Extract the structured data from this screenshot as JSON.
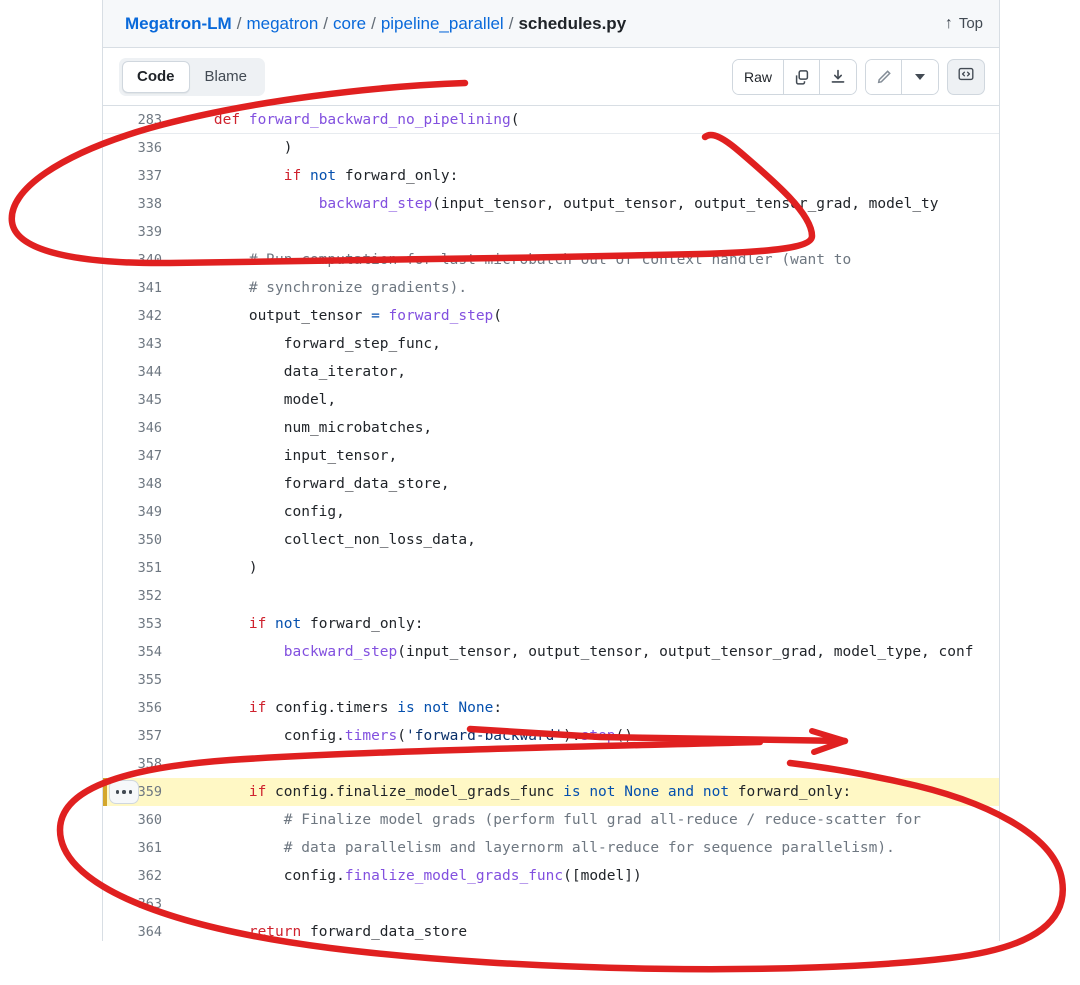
{
  "header": {
    "breadcrumb": {
      "repo": "Megatron-LM",
      "parts": [
        "megatron",
        "core",
        "pipeline_parallel"
      ],
      "current": "schedules.py",
      "separator": "/"
    },
    "top_link": {
      "label": "Top",
      "icon": "arrow-up-icon",
      "glyph": "↑"
    }
  },
  "toolbar": {
    "tabs": [
      {
        "label": "Code",
        "active": true
      },
      {
        "label": "Blame",
        "active": false
      }
    ],
    "raw_label": "Raw",
    "copy_icon": "copy-icon",
    "download_icon": "download-icon",
    "edit_icon": "pencil-icon",
    "dropdown_icon": "chevron-down-icon",
    "symbols_icon": "code-brackets-icon"
  },
  "sticky": {
    "number": "283",
    "tokens": [
      {
        "t": "    ",
        "c": "plain"
      },
      {
        "t": "def",
        "c": "kw"
      },
      {
        "t": " ",
        "c": "plain"
      },
      {
        "t": "forward_backward_no_pipelining",
        "c": "fn"
      },
      {
        "t": "(",
        "c": "plain"
      }
    ]
  },
  "colors": {
    "accent_link": "#0969da",
    "keyword": "#cf222e",
    "function": "#8250df",
    "operator": "#0550ae",
    "comment": "#6e7781",
    "highlight_bg": "#fff8c5",
    "highlight_border": "#d4a72c",
    "annotation": "#e02020",
    "panel_border": "#d8dee4",
    "header_bg": "#f6f8fa"
  },
  "code_lines": [
    {
      "number": "336",
      "highlight": false,
      "tokens": [
        {
          "t": "            )",
          "c": "plain"
        }
      ]
    },
    {
      "number": "337",
      "highlight": false,
      "tokens": [
        {
          "t": "            ",
          "c": "plain"
        },
        {
          "t": "if",
          "c": "kw"
        },
        {
          "t": " ",
          "c": "plain"
        },
        {
          "t": "not",
          "c": "op"
        },
        {
          "t": " forward_only:",
          "c": "plain"
        }
      ]
    },
    {
      "number": "338",
      "highlight": false,
      "tokens": [
        {
          "t": "                ",
          "c": "plain"
        },
        {
          "t": "backward_step",
          "c": "fn"
        },
        {
          "t": "(input_tensor, output_tensor, output_tensor_grad, model_ty",
          "c": "plain"
        }
      ]
    },
    {
      "number": "339",
      "highlight": false,
      "tokens": [
        {
          "t": "",
          "c": "plain"
        }
      ]
    },
    {
      "number": "340",
      "highlight": false,
      "tokens": [
        {
          "t": "        ",
          "c": "plain"
        },
        {
          "t": "# Run computation for last microbatch out of context handler (want to",
          "c": "cmt"
        }
      ]
    },
    {
      "number": "341",
      "highlight": false,
      "tokens": [
        {
          "t": "        ",
          "c": "plain"
        },
        {
          "t": "# synchronize gradients).",
          "c": "cmt"
        }
      ]
    },
    {
      "number": "342",
      "highlight": false,
      "tokens": [
        {
          "t": "        output_tensor ",
          "c": "plain"
        },
        {
          "t": "=",
          "c": "op"
        },
        {
          "t": " ",
          "c": "plain"
        },
        {
          "t": "forward_step",
          "c": "fn"
        },
        {
          "t": "(",
          "c": "plain"
        }
      ]
    },
    {
      "number": "343",
      "highlight": false,
      "tokens": [
        {
          "t": "            forward_step_func,",
          "c": "plain"
        }
      ]
    },
    {
      "number": "344",
      "highlight": false,
      "tokens": [
        {
          "t": "            data_iterator,",
          "c": "plain"
        }
      ]
    },
    {
      "number": "345",
      "highlight": false,
      "tokens": [
        {
          "t": "            model,",
          "c": "plain"
        }
      ]
    },
    {
      "number": "346",
      "highlight": false,
      "tokens": [
        {
          "t": "            num_microbatches,",
          "c": "plain"
        }
      ]
    },
    {
      "number": "347",
      "highlight": false,
      "tokens": [
        {
          "t": "            input_tensor,",
          "c": "plain"
        }
      ]
    },
    {
      "number": "348",
      "highlight": false,
      "tokens": [
        {
          "t": "            forward_data_store,",
          "c": "plain"
        }
      ]
    },
    {
      "number": "349",
      "highlight": false,
      "tokens": [
        {
          "t": "            config,",
          "c": "plain"
        }
      ]
    },
    {
      "number": "350",
      "highlight": false,
      "tokens": [
        {
          "t": "            collect_non_loss_data,",
          "c": "plain"
        }
      ]
    },
    {
      "number": "351",
      "highlight": false,
      "tokens": [
        {
          "t": "        )",
          "c": "plain"
        }
      ]
    },
    {
      "number": "352",
      "highlight": false,
      "tokens": [
        {
          "t": "",
          "c": "plain"
        }
      ]
    },
    {
      "number": "353",
      "highlight": false,
      "tokens": [
        {
          "t": "        ",
          "c": "plain"
        },
        {
          "t": "if",
          "c": "kw"
        },
        {
          "t": " ",
          "c": "plain"
        },
        {
          "t": "not",
          "c": "op"
        },
        {
          "t": " forward_only:",
          "c": "plain"
        }
      ]
    },
    {
      "number": "354",
      "highlight": false,
      "tokens": [
        {
          "t": "            ",
          "c": "plain"
        },
        {
          "t": "backward_step",
          "c": "fn"
        },
        {
          "t": "(input_tensor, output_tensor, output_tensor_grad, model_type, conf",
          "c": "plain"
        }
      ]
    },
    {
      "number": "355",
      "highlight": false,
      "tokens": [
        {
          "t": "",
          "c": "plain"
        }
      ]
    },
    {
      "number": "356",
      "highlight": false,
      "tokens": [
        {
          "t": "        ",
          "c": "plain"
        },
        {
          "t": "if",
          "c": "kw"
        },
        {
          "t": " config.timers ",
          "c": "plain"
        },
        {
          "t": "is",
          "c": "op"
        },
        {
          "t": " ",
          "c": "plain"
        },
        {
          "t": "not",
          "c": "op"
        },
        {
          "t": " ",
          "c": "plain"
        },
        {
          "t": "None",
          "c": "op"
        },
        {
          "t": ":",
          "c": "plain"
        }
      ]
    },
    {
      "number": "357",
      "highlight": false,
      "tokens": [
        {
          "t": "            config.",
          "c": "plain"
        },
        {
          "t": "timers",
          "c": "fn"
        },
        {
          "t": "(",
          "c": "plain"
        },
        {
          "t": "'forward-backward'",
          "c": "str"
        },
        {
          "t": ").",
          "c": "plain"
        },
        {
          "t": "stop",
          "c": "fn"
        },
        {
          "t": "()",
          "c": "plain"
        }
      ]
    },
    {
      "number": "358",
      "highlight": false,
      "tokens": [
        {
          "t": "",
          "c": "plain"
        }
      ]
    },
    {
      "number": "359",
      "highlight": true,
      "expander": "dots-expander-icon",
      "tokens": [
        {
          "t": "        ",
          "c": "plain"
        },
        {
          "t": "if",
          "c": "kw"
        },
        {
          "t": " config.finalize_model_grads_func ",
          "c": "plain"
        },
        {
          "t": "is",
          "c": "op"
        },
        {
          "t": " ",
          "c": "plain"
        },
        {
          "t": "not",
          "c": "op"
        },
        {
          "t": " ",
          "c": "plain"
        },
        {
          "t": "None",
          "c": "op"
        },
        {
          "t": " ",
          "c": "plain"
        },
        {
          "t": "and",
          "c": "op"
        },
        {
          "t": " ",
          "c": "plain"
        },
        {
          "t": "not",
          "c": "op"
        },
        {
          "t": " forward_only:",
          "c": "plain"
        }
      ]
    },
    {
      "number": "360",
      "highlight": false,
      "tokens": [
        {
          "t": "            ",
          "c": "plain"
        },
        {
          "t": "# Finalize model grads (perform full grad all-reduce / reduce-scatter for",
          "c": "cmt"
        }
      ]
    },
    {
      "number": "361",
      "highlight": false,
      "tokens": [
        {
          "t": "            ",
          "c": "plain"
        },
        {
          "t": "# data parallelism and layernorm all-reduce for sequence parallelism).",
          "c": "cmt"
        }
      ]
    },
    {
      "number": "362",
      "highlight": false,
      "tokens": [
        {
          "t": "            config.",
          "c": "plain"
        },
        {
          "t": "finalize_model_grads_func",
          "c": "fn"
        },
        {
          "t": "([model])",
          "c": "plain"
        }
      ]
    },
    {
      "number": "363",
      "highlight": false,
      "tokens": [
        {
          "t": "",
          "c": "plain"
        }
      ]
    },
    {
      "number": "364",
      "highlight": false,
      "tokens": [
        {
          "t": "        ",
          "c": "plain"
        },
        {
          "t": "return",
          "c": "kw"
        },
        {
          "t": " forward_data_store",
          "c": "plain"
        }
      ]
    }
  ],
  "annotations": {
    "color": "#e02020",
    "stroke_width": 6,
    "shapes": [
      {
        "name": "top-circle-annotation",
        "kind": "freehand-ellipse"
      },
      {
        "name": "arrow-annotation",
        "kind": "freehand-arrow"
      },
      {
        "name": "bottom-circle-annotation",
        "kind": "freehand-ellipse"
      }
    ]
  }
}
